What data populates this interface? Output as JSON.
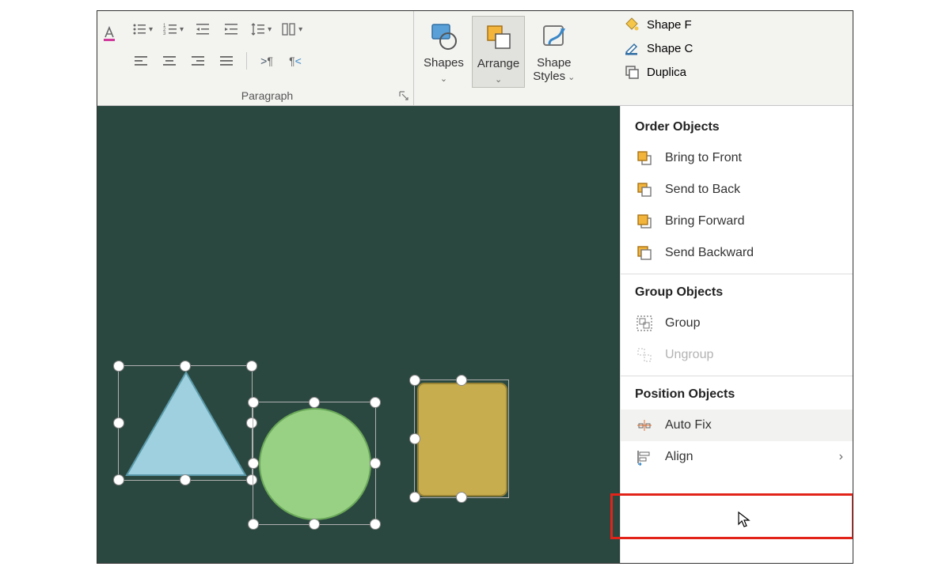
{
  "ribbon": {
    "paragraph_label": "Paragraph",
    "shapes_label": "Shapes",
    "arrange_label": "Arrange",
    "shape_styles_label": "Shape\nStyles",
    "side_items": {
      "fill": "Shape F",
      "outline": "Shape C",
      "duplicate": "Duplica"
    }
  },
  "dropdown": {
    "sections": {
      "order": "Order Objects",
      "group": "Group Objects",
      "position": "Position Objects"
    },
    "items": {
      "bring_front": "Bring to Front",
      "send_back": "Send to Back",
      "bring_forward": "Bring Forward",
      "send_backward": "Send Backward",
      "group": "Group",
      "ungroup": "Ungroup",
      "auto_fix": "Auto Fix",
      "align": "Align"
    }
  },
  "canvas": {
    "shapes": {
      "triangle_color": "#9ed0df",
      "circle_color": "#98d184",
      "rect_color": "#c8ad4e"
    }
  }
}
